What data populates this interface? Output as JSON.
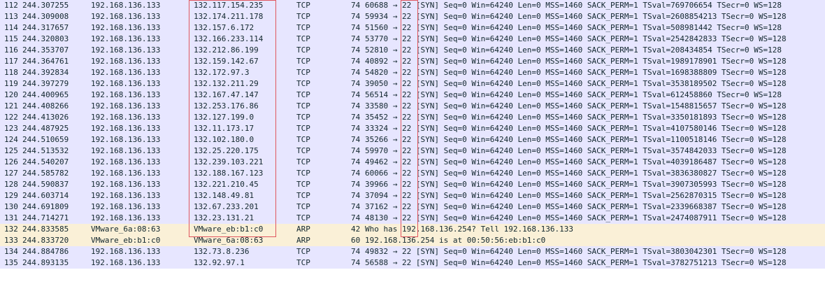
{
  "rows": [
    {
      "no": "112",
      "time": "244.307255",
      "src": "192.168.136.133",
      "dst": "132.117.154.235",
      "proto": "TCP",
      "len": "74",
      "info": "60688 → 22 [SYN] Seq=0 Win=64240 Len=0 MSS=1460 SACK_PERM=1 TSval=769706654 TSecr=0 WS=128",
      "kind": "tcp"
    },
    {
      "no": "113",
      "time": "244.309008",
      "src": "192.168.136.133",
      "dst": "132.174.211.178",
      "proto": "TCP",
      "len": "74",
      "info": "59934 → 22 [SYN] Seq=0 Win=64240 Len=0 MSS=1460 SACK_PERM=1 TSval=2608854213 TSecr=0 WS=128",
      "kind": "tcp"
    },
    {
      "no": "114",
      "time": "244.317657",
      "src": "192.168.136.133",
      "dst": "132.157.6.172",
      "proto": "TCP",
      "len": "74",
      "info": "51560 → 22 [SYN] Seq=0 Win=64240 Len=0 MSS=1460 SACK_PERM=1 TSval=508981442 TSecr=0 WS=128",
      "kind": "tcp"
    },
    {
      "no": "115",
      "time": "244.320803",
      "src": "192.168.136.133",
      "dst": "132.166.233.114",
      "proto": "TCP",
      "len": "74",
      "info": "53770 → 22 [SYN] Seq=0 Win=64240 Len=0 MSS=1460 SACK_PERM=1 TSval=2542842833 TSecr=0 WS=128",
      "kind": "tcp"
    },
    {
      "no": "116",
      "time": "244.353707",
      "src": "192.168.136.133",
      "dst": "132.212.86.199",
      "proto": "TCP",
      "len": "74",
      "info": "52810 → 22 [SYN] Seq=0 Win=64240 Len=0 MSS=1460 SACK_PERM=1 TSval=208434854 TSecr=0 WS=128",
      "kind": "tcp"
    },
    {
      "no": "117",
      "time": "244.364761",
      "src": "192.168.136.133",
      "dst": "132.159.142.67",
      "proto": "TCP",
      "len": "74",
      "info": "40892 → 22 [SYN] Seq=0 Win=64240 Len=0 MSS=1460 SACK_PERM=1 TSval=1989178901 TSecr=0 WS=128",
      "kind": "tcp"
    },
    {
      "no": "118",
      "time": "244.392834",
      "src": "192.168.136.133",
      "dst": "132.172.97.3",
      "proto": "TCP",
      "len": "74",
      "info": "54820 → 22 [SYN] Seq=0 Win=64240 Len=0 MSS=1460 SACK_PERM=1 TSval=1698388809 TSecr=0 WS=128",
      "kind": "tcp"
    },
    {
      "no": "119",
      "time": "244.397279",
      "src": "192.168.136.133",
      "dst": "132.132.211.29",
      "proto": "TCP",
      "len": "74",
      "info": "39050 → 22 [SYN] Seq=0 Win=64240 Len=0 MSS=1460 SACK_PERM=1 TSval=3538189502 TSecr=0 WS=128",
      "kind": "tcp"
    },
    {
      "no": "120",
      "time": "244.400965",
      "src": "192.168.136.133",
      "dst": "132.167.47.147",
      "proto": "TCP",
      "len": "74",
      "info": "56514 → 22 [SYN] Seq=0 Win=64240 Len=0 MSS=1460 SACK_PERM=1 TSval=612458860 TSecr=0 WS=128",
      "kind": "tcp"
    },
    {
      "no": "121",
      "time": "244.408266",
      "src": "192.168.136.133",
      "dst": "132.253.176.86",
      "proto": "TCP",
      "len": "74",
      "info": "33580 → 22 [SYN] Seq=0 Win=64240 Len=0 MSS=1460 SACK_PERM=1 TSval=1548815657 TSecr=0 WS=128",
      "kind": "tcp"
    },
    {
      "no": "122",
      "time": "244.413026",
      "src": "192.168.136.133",
      "dst": "132.127.199.0",
      "proto": "TCP",
      "len": "74",
      "info": "35452 → 22 [SYN] Seq=0 Win=64240 Len=0 MSS=1460 SACK_PERM=1 TSval=3350181893 TSecr=0 WS=128",
      "kind": "tcp"
    },
    {
      "no": "123",
      "time": "244.487925",
      "src": "192.168.136.133",
      "dst": "132.11.173.17",
      "proto": "TCP",
      "len": "74",
      "info": "33324 → 22 [SYN] Seq=0 Win=64240 Len=0 MSS=1460 SACK_PERM=1 TSval=4107580146 TSecr=0 WS=128",
      "kind": "tcp"
    },
    {
      "no": "124",
      "time": "244.510659",
      "src": "192.168.136.133",
      "dst": "132.102.180.0",
      "proto": "TCP",
      "len": "74",
      "info": "35266 → 22 [SYN] Seq=0 Win=64240 Len=0 MSS=1460 SACK_PERM=1 TSval=1100518146 TSecr=0 WS=128",
      "kind": "tcp"
    },
    {
      "no": "125",
      "time": "244.513532",
      "src": "192.168.136.133",
      "dst": "132.25.220.175",
      "proto": "TCP",
      "len": "74",
      "info": "59970 → 22 [SYN] Seq=0 Win=64240 Len=0 MSS=1460 SACK_PERM=1 TSval=3574842033 TSecr=0 WS=128",
      "kind": "tcp"
    },
    {
      "no": "126",
      "time": "244.540207",
      "src": "192.168.136.133",
      "dst": "132.239.103.221",
      "proto": "TCP",
      "len": "74",
      "info": "49462 → 22 [SYN] Seq=0 Win=64240 Len=0 MSS=1460 SACK_PERM=1 TSval=4039186487 TSecr=0 WS=128",
      "kind": "tcp"
    },
    {
      "no": "127",
      "time": "244.585782",
      "src": "192.168.136.133",
      "dst": "132.188.167.123",
      "proto": "TCP",
      "len": "74",
      "info": "60066 → 22 [SYN] Seq=0 Win=64240 Len=0 MSS=1460 SACK_PERM=1 TSval=3836380827 TSecr=0 WS=128",
      "kind": "tcp"
    },
    {
      "no": "128",
      "time": "244.590837",
      "src": "192.168.136.133",
      "dst": "132.221.210.45",
      "proto": "TCP",
      "len": "74",
      "info": "39966 → 22 [SYN] Seq=0 Win=64240 Len=0 MSS=1460 SACK_PERM=1 TSval=3907305993 TSecr=0 WS=128",
      "kind": "tcp"
    },
    {
      "no": "129",
      "time": "244.603714",
      "src": "192.168.136.133",
      "dst": "132.148.49.81",
      "proto": "TCP",
      "len": "74",
      "info": "37094 → 22 [SYN] Seq=0 Win=64240 Len=0 MSS=1460 SACK_PERM=1 TSval=2562870315 TSecr=0 WS=128",
      "kind": "tcp"
    },
    {
      "no": "130",
      "time": "244.691809",
      "src": "192.168.136.133",
      "dst": "132.67.233.201",
      "proto": "TCP",
      "len": "74",
      "info": "37162 → 22 [SYN] Seq=0 Win=64240 Len=0 MSS=1460 SACK_PERM=1 TSval=2339668387 TSecr=0 WS=128",
      "kind": "tcp"
    },
    {
      "no": "131",
      "time": "244.714271",
      "src": "192.168.136.133",
      "dst": "132.23.131.21",
      "proto": "TCP",
      "len": "74",
      "info": "48130 → 22 [SYN] Seq=0 Win=64240 Len=0 MSS=1460 SACK_PERM=1 TSval=2474087911 TSecr=0 WS=128",
      "kind": "tcp"
    },
    {
      "no": "132",
      "time": "244.833585",
      "src": "VMware_6a:08:63",
      "dst": "VMware_eb:b1:c0",
      "proto": "ARP",
      "len": "42",
      "info": "Who has 192.168.136.254? Tell 192.168.136.133",
      "kind": "arp"
    },
    {
      "no": "133",
      "time": "244.833720",
      "src": "VMware_eb:b1:c0",
      "dst": "VMware_6a:08:63",
      "proto": "ARP",
      "len": "60",
      "info": "192.168.136.254 is at 00:50:56:eb:b1:c0",
      "kind": "arp"
    },
    {
      "no": "134",
      "time": "244.884786",
      "src": "192.168.136.133",
      "dst": "132.73.8.236",
      "proto": "TCP",
      "len": "74",
      "info": "49832 → 22 [SYN] Seq=0 Win=64240 Len=0 MSS=1460 SACK_PERM=1 TSval=3803042301 TSecr=0 WS=128",
      "kind": "tcp"
    },
    {
      "no": "135",
      "time": "244.893135",
      "src": "192.168.136.133",
      "dst": "132.92.97.1",
      "proto": "TCP",
      "len": "74",
      "info": "56588 → 22 [SYN] Seq=0 Win=64240 Len=0 MSS=1460 SACK_PERM=1 TSval=3782751213 TSecr=0 WS=128",
      "kind": "tcp"
    }
  ],
  "colors": {
    "tcp_row_bg": "#e7e6ff",
    "arp_row_bg": "#faf0d7",
    "text": "#12272e",
    "highlight_box": "#e0575f"
  }
}
